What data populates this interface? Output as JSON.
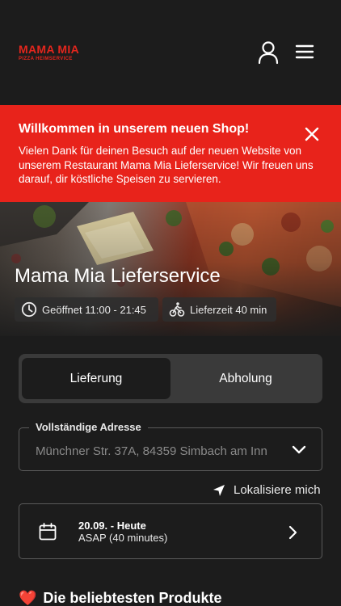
{
  "header": {
    "logo_main": "MAMA MIA",
    "logo_sub": "PIZZA HEIMSERVICE"
  },
  "banner": {
    "title": "Willkommen in unserem neuen Shop!",
    "text": "Vielen Dank für deinen Besuch auf der neuen Website von unserem Restaurant Mama Mia Lieferservice! Wir freuen uns darauf, dir köstliche Speisen zu servieren."
  },
  "hero": {
    "title": "Mama Mia Lieferservice",
    "open_hours": "Geöffnet 11:00 - 21:45",
    "delivery_time": "Lieferzeit 40 min"
  },
  "order_mode": {
    "options": [
      "Lieferung",
      "Abholung"
    ],
    "selected": "Lieferung"
  },
  "address": {
    "label": "Vollständige Adresse",
    "value": "Münchner Str. 37A, 84359 Simbach am Inn"
  },
  "locate": {
    "label": "Lokalisiere mich"
  },
  "schedule": {
    "date": "20.09. - Heute",
    "time": "ASAP (40 minutes)"
  },
  "popular": {
    "emoji": "❤️",
    "title": "Die beliebtesten Produkte"
  },
  "colors": {
    "brand_red": "#e8231b",
    "background": "#1c1c1c"
  }
}
